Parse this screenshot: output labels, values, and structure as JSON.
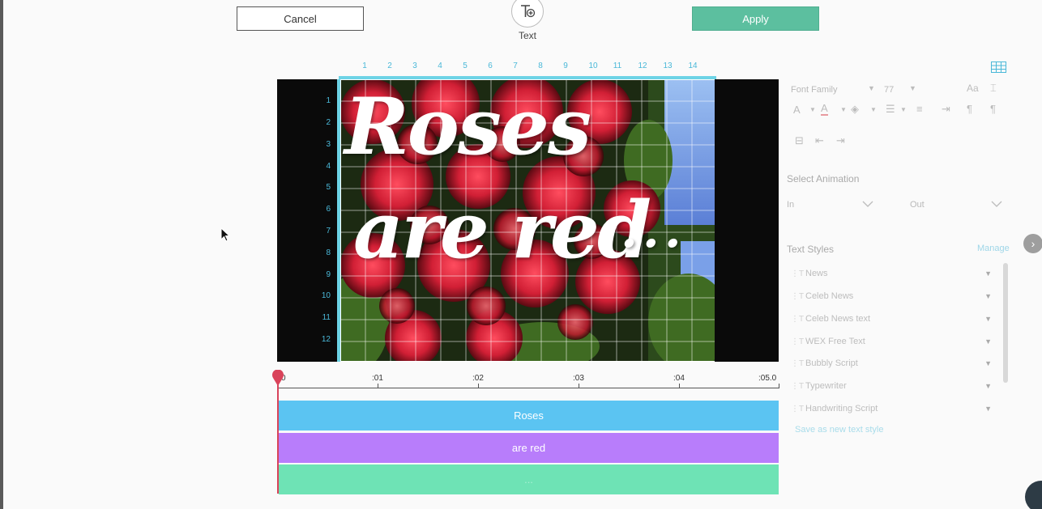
{
  "header": {
    "cancel_label": "Cancel",
    "apply_label": "Apply",
    "text_tool_label": "Text"
  },
  "ruler": {
    "columns": [
      "1",
      "2",
      "3",
      "4",
      "5",
      "6",
      "7",
      "8",
      "9",
      "10",
      "11",
      "12",
      "13",
      "14"
    ],
    "rows": [
      "1",
      "2",
      "3",
      "4",
      "5",
      "6",
      "7",
      "8",
      "9",
      "10",
      "11",
      "12"
    ]
  },
  "canvas": {
    "caption_line1": "Roses",
    "caption_line2": "are red",
    "caption_line3": "..."
  },
  "timeline": {
    "ticks": [
      "0",
      ":01",
      ":02",
      ":03",
      ":04",
      ":05.0"
    ],
    "tracks": [
      {
        "label": "Roses",
        "color": "#5bc4f2"
      },
      {
        "label": "are red",
        "color": "#b87dfb"
      },
      {
        "label": "...",
        "color": "#6ee3b5"
      }
    ]
  },
  "panel": {
    "font_family_placeholder": "Font Family",
    "font_size": "77",
    "animation_heading": "Select Animation",
    "anim_in": "In",
    "anim_out": "Out",
    "text_styles_heading": "Text Styles",
    "manage_label": "Manage",
    "styles": [
      "News",
      "Celeb News",
      "Celeb News text",
      "WEX Free Text",
      "Bubbly Script",
      "Typewriter",
      "Handwriting Script"
    ],
    "save_style_label": "Save as new text style"
  },
  "colors": {
    "accent": "#5cbf9f",
    "ruler": "#6dd3e6",
    "playhead": "#d9435a"
  }
}
